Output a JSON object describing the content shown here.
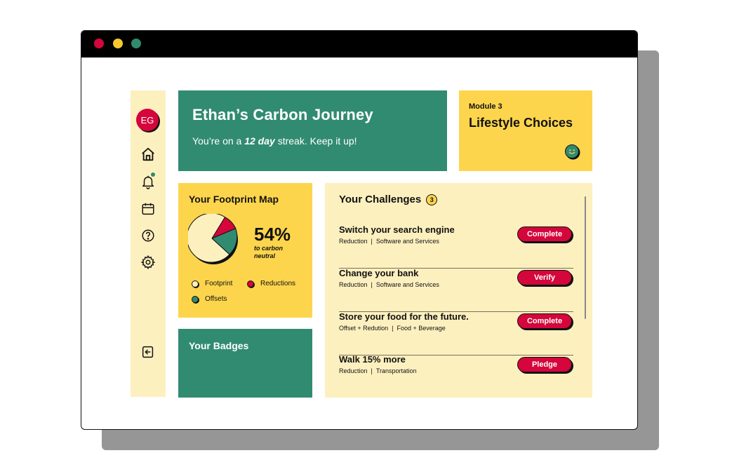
{
  "user": {
    "initials": "EG"
  },
  "journey": {
    "title": "Ethan’s Carbon Journey",
    "streak_prefix": "You’re on a ",
    "streak_value": "12 day",
    "streak_suffix": " streak. Keep it up!"
  },
  "module": {
    "label": "Module 3",
    "title": "Lifestyle Choices"
  },
  "footprint": {
    "title": "Your Footprint Map",
    "percent": "54%",
    "percent_caption": "to carbon neutral",
    "legend": [
      {
        "label": "Footprint",
        "color": "#fdf0bf"
      },
      {
        "label": "Reductions",
        "color": "#d4063b"
      },
      {
        "label": "Offsets",
        "color": "#318b70"
      }
    ]
  },
  "badges": {
    "title": "Your Badges"
  },
  "challenges": {
    "title": "Your Challenges",
    "count": "3",
    "items": [
      {
        "title": "Switch your search engine",
        "category": "Reduction",
        "area": "Software and Services",
        "action": "Complete"
      },
      {
        "title": "Change your bank",
        "category": "Reduction",
        "area": "Software and Services",
        "action": "Verify"
      },
      {
        "title": "Store your food for the future.",
        "category": "Offset + Redution",
        "area": "Food + Beverage",
        "action": "Complete"
      },
      {
        "title": "Walk 15% more",
        "category": "Reduction",
        "area": "Transportation",
        "action": "Pledge"
      }
    ]
  },
  "icons": [
    "home-icon",
    "bell-icon",
    "calendar-icon",
    "help-icon",
    "settings-icon",
    "logout-icon",
    "smiley-icon"
  ],
  "colors": {
    "green": "#318b70",
    "yellow": "#fdd54d",
    "cream": "#fdf0bf",
    "red": "#d4063b"
  }
}
